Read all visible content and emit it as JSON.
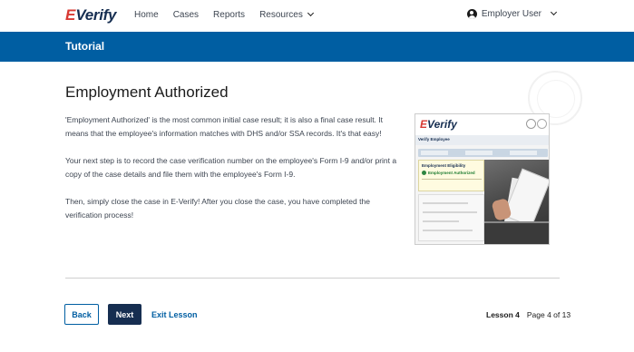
{
  "header": {
    "logo_e": "E",
    "logo_text": "Verify",
    "nav": [
      "Home",
      "Cases",
      "Reports",
      "Resources"
    ],
    "user": "Employer User"
  },
  "banner": {
    "title": "Tutorial"
  },
  "content": {
    "title": "Employment Authorized",
    "paragraphs": [
      "'Employment Authorized' is the most common initial case result; it is also a final case result. It means that the employee's information matches with DHS and/or SSA records. It's that easy!",
      "Your next step is to record the case verification number on the employee's Form I-9 and/or print a copy of the case details and file them with the employee's Form I-9.",
      "Then, simply close the case in E-Verify! After you close the case, you have completed the verification process!"
    ]
  },
  "screenshot": {
    "logo_e": "E",
    "logo_text": "Verify",
    "heading": "Verify Employee",
    "panel_title": "Employment Eligibility",
    "status": "Employment Authorized"
  },
  "footer": {
    "back_label": "Back",
    "next_label": "Next",
    "exit_label": "Exit Lesson",
    "lesson": "Lesson 4",
    "page": "Page 4 of 13"
  },
  "colors": {
    "banner": "#005ea2",
    "next_button": "#162e51",
    "logo_e": "#d83933"
  }
}
